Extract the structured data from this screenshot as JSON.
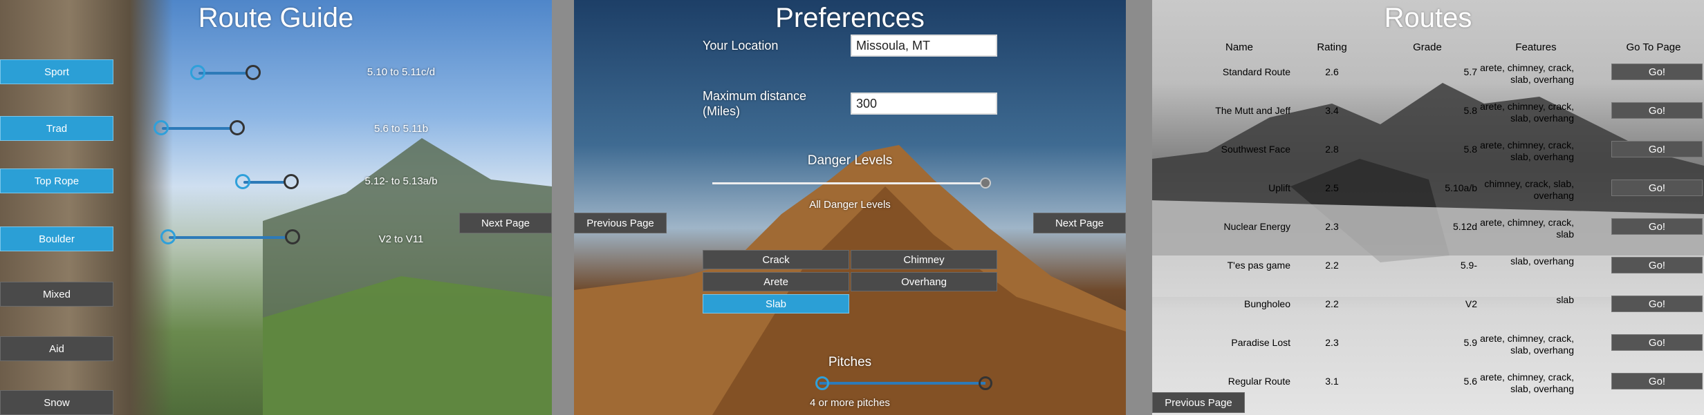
{
  "screen1": {
    "title": "Route Guide",
    "types": [
      {
        "label": "Sport",
        "style": "blue",
        "grade": "5.10 to 5.11c/d"
      },
      {
        "label": "Trad",
        "style": "blue",
        "grade": "5.6 to 5.11b"
      },
      {
        "label": "Top Rope",
        "style": "blue",
        "grade": "5.12- to 5.13a/b"
      },
      {
        "label": "Boulder",
        "style": "blue",
        "grade": "V2 to V11"
      },
      {
        "label": "Mixed",
        "style": "gray",
        "grade": ""
      },
      {
        "label": "Aid",
        "style": "gray",
        "grade": ""
      },
      {
        "label": "Snow",
        "style": "gray",
        "grade": ""
      }
    ],
    "next_label": "Next Page"
  },
  "screen2": {
    "title": "Preferences",
    "location_label": "Your Location",
    "location_value": "Missoula, MT",
    "distance_label": "Maximum distance\n(Miles)",
    "distance_value": "300",
    "danger_label": "Danger Levels",
    "danger_value_text": "All Danger Levels",
    "danger_level_fraction": 1.0,
    "prev_label": "Previous Page",
    "next_label": "Next Page",
    "features": [
      {
        "label": "Crack",
        "selected": false
      },
      {
        "label": "Chimney",
        "selected": false
      },
      {
        "label": "Arete",
        "selected": false
      },
      {
        "label": "Overhang",
        "selected": false
      },
      {
        "label": "Slab",
        "selected": true
      }
    ],
    "pitches_label": "Pitches",
    "pitches_value_text": "4 or more pitches",
    "pitches_fraction": 1.0
  },
  "screen3": {
    "title": "Routes",
    "headers": [
      "Name",
      "Rating",
      "Grade",
      "Features",
      "Go To Page"
    ],
    "go_label": "Go!",
    "prev_label": "Previous Page",
    "rows": [
      {
        "name": "Standard Route",
        "rating": "2.6",
        "grade": "5.7",
        "features": "arete, chimney, crack,\nslab, overhang"
      },
      {
        "name": "The Mutt and Jeff",
        "rating": "3.4",
        "grade": "5.8",
        "features": "arete, chimney, crack,\nslab, overhang"
      },
      {
        "name": "Southwest Face",
        "rating": "2.8",
        "grade": "5.8",
        "features": "arete, chimney, crack,\nslab, overhang"
      },
      {
        "name": "Uplift",
        "rating": "2.5",
        "grade": "5.10a/b",
        "features": "chimney, crack, slab,\noverhang"
      },
      {
        "name": "Nuclear Energy",
        "rating": "2.3",
        "grade": "5.12d",
        "features": "arete, chimney, crack,\nslab"
      },
      {
        "name": "T'es pas game",
        "rating": "2.2",
        "grade": "5.9-",
        "features": "slab, overhang"
      },
      {
        "name": "Bungholeo",
        "rating": "2.2",
        "grade": "V2",
        "features": "slab"
      },
      {
        "name": "Paradise Lost",
        "rating": "2.3",
        "grade": "5.9",
        "features": "arete, chimney, crack,\nslab, overhang"
      },
      {
        "name": "Regular Route",
        "rating": "3.1",
        "grade": "5.6",
        "features": "arete, chimney, crack,\nslab, overhang"
      }
    ]
  }
}
